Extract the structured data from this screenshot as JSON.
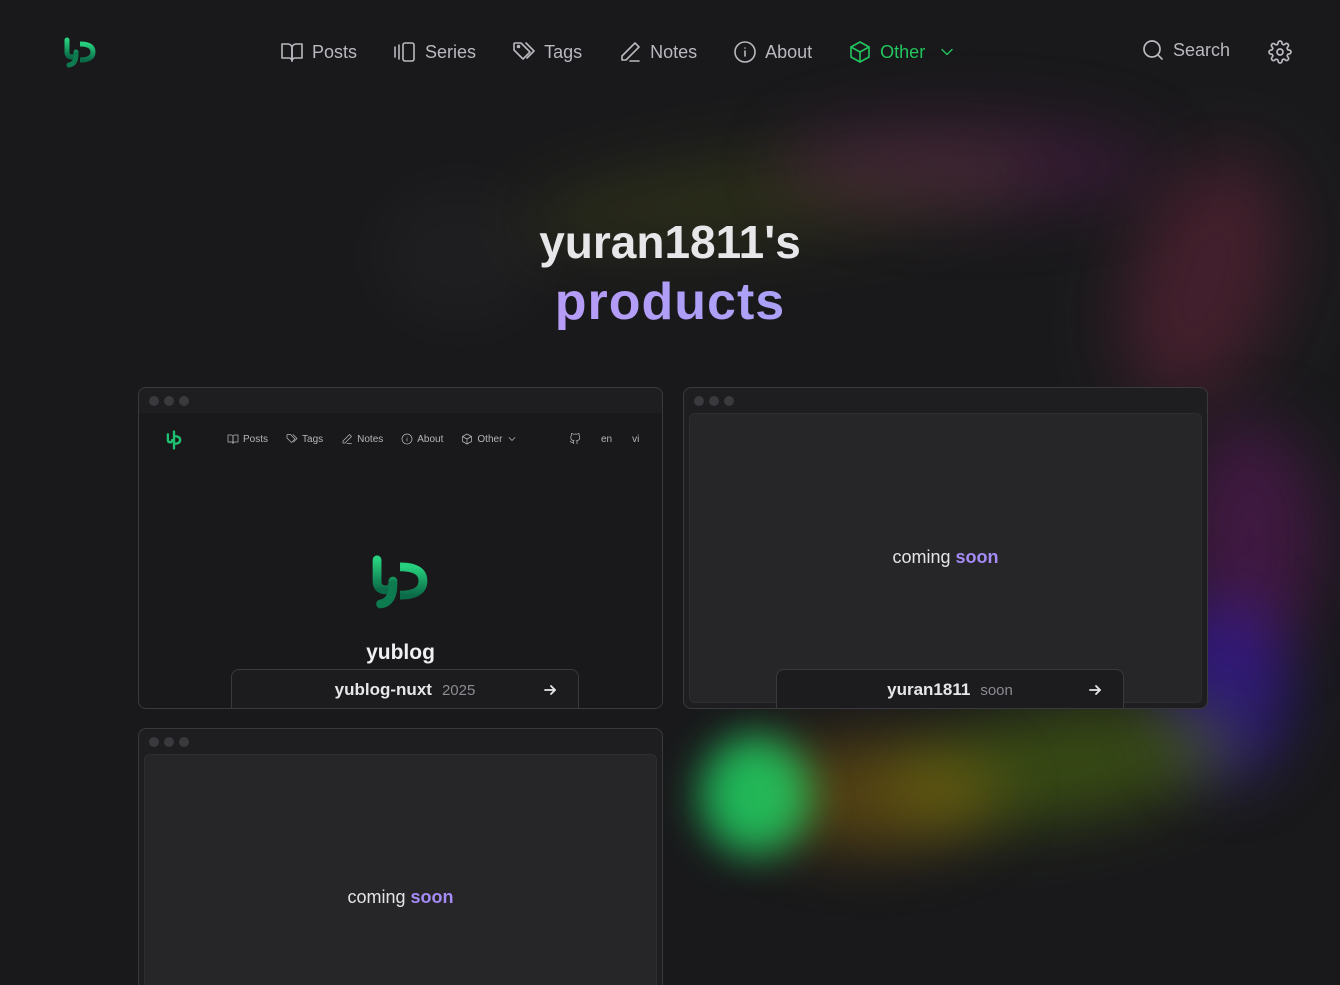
{
  "header": {
    "nav": [
      {
        "label": "Posts",
        "icon": "book-open-icon"
      },
      {
        "label": "Series",
        "icon": "gallery-icon"
      },
      {
        "label": "Tags",
        "icon": "tags-icon"
      },
      {
        "label": "Notes",
        "icon": "pen-icon"
      },
      {
        "label": "About",
        "icon": "info-icon"
      },
      {
        "label": "Other",
        "icon": "package-icon",
        "active": true
      }
    ],
    "search_label": "Search"
  },
  "hero": {
    "line1": "yuran1811's",
    "line2": "products"
  },
  "products": [
    {
      "name": "yublog-nuxt",
      "year": "2025",
      "preview": {
        "nav": [
          "Posts",
          "Tags",
          "Notes",
          "About",
          "Other"
        ],
        "langs": [
          "en",
          "vi"
        ],
        "title": "yublog"
      }
    },
    {
      "name": "yuran1811",
      "year": "soon",
      "placeholder": {
        "text": "coming",
        "highlight": "soon"
      }
    },
    {
      "name": "",
      "year": "",
      "placeholder": {
        "text": "coming",
        "highlight": "soon"
      }
    }
  ],
  "colors": {
    "background": "#19191b",
    "accent_green": "#22c55e",
    "accent_purple": "#a48bf6"
  }
}
